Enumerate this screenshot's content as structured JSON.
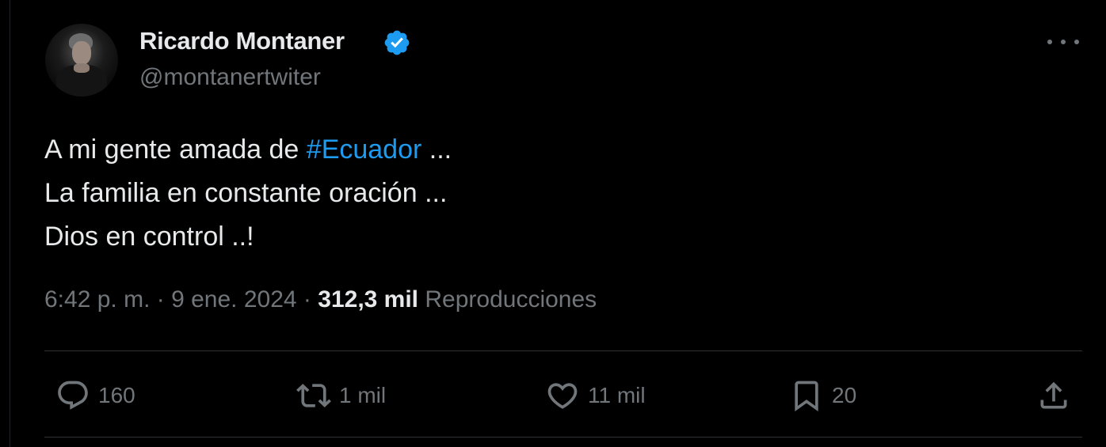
{
  "author": {
    "display_name": "Ricardo Montaner",
    "handle": "@montanertwiter",
    "verified": true
  },
  "tweet": {
    "line1_prefix": "A mi gente amada de ",
    "hashtag": "#Ecuador",
    "line1_suffix": " ...",
    "line2": "La familia en constante oración ...",
    "line3": "Dios en control ..!"
  },
  "meta": {
    "time": "6:42 p. m.",
    "separator": "·",
    "date": "9 ene. 2024",
    "views_count": "312,3 mil",
    "views_label": "Reproducciones"
  },
  "actions": {
    "replies": "160",
    "retweets": "1 mil",
    "likes": "11 mil",
    "bookmarks": "20"
  },
  "colors": {
    "background": "#000000",
    "text": "#e7e9ea",
    "secondary": "#71767b",
    "accent": "#1d9bf0",
    "divider": "#2f3336"
  },
  "icons": {
    "reply": "reply-icon",
    "retweet": "retweet-icon",
    "like": "heart-icon",
    "bookmark": "bookmark-icon",
    "share": "share-icon",
    "more": "more-icon",
    "verified": "verified-badge-icon"
  }
}
